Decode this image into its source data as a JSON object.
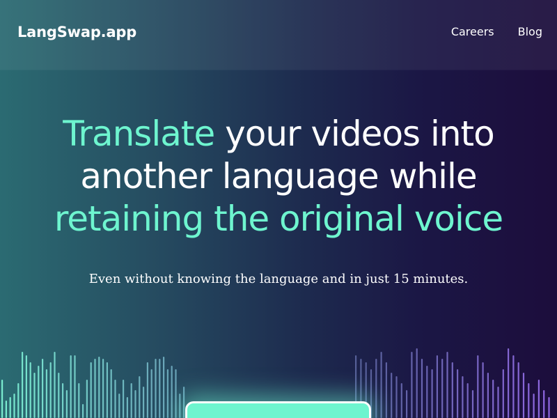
{
  "header": {
    "logo": "LangSwap.app",
    "nav": [
      {
        "label": "Careers"
      },
      {
        "label": "Blog"
      }
    ]
  },
  "hero": {
    "headline": {
      "line1_accent": "Translate",
      "line1_rest": " your videos into",
      "line2": "another language while",
      "line3_accent": "retaining the original voice"
    },
    "subheading": "Even without knowing the language and in just 15 minutes."
  },
  "cta": {
    "label": ""
  },
  "colors": {
    "accent": "#6ef5cf",
    "wave_left": "#7ef3d4",
    "wave_right": "#9a6cf0",
    "background_left": "#2b6b72",
    "background_right": "#1c0d3c"
  }
}
